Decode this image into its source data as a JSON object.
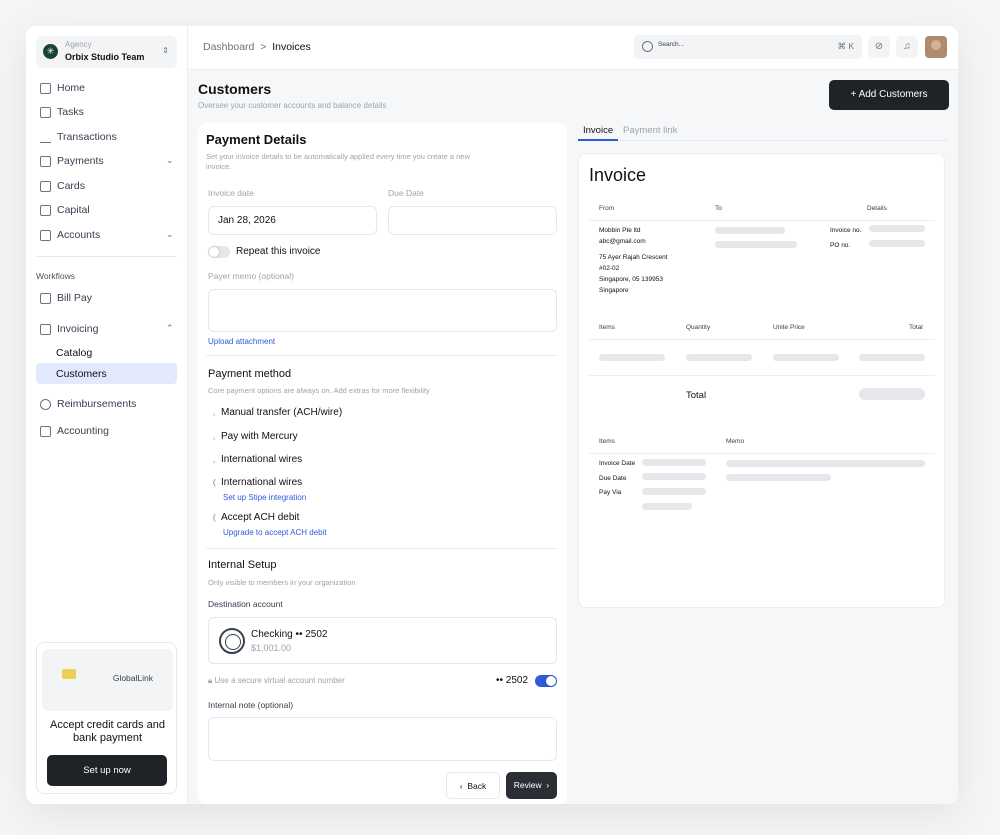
{
  "sidebar": {
    "team": {
      "org": "Agency",
      "name": "Orbix Studio Team"
    },
    "items": [
      {
        "label": "Home"
      },
      {
        "label": "Tasks"
      },
      {
        "label": "Transactions"
      },
      {
        "label": "Payments"
      },
      {
        "label": "Cards"
      },
      {
        "label": "Capital"
      },
      {
        "label": "Accounts"
      }
    ],
    "workflows_label": "Workflows",
    "workflows": [
      {
        "label": "Bill Pay"
      },
      {
        "label": "Invoicing"
      },
      {
        "label": "Catalog"
      },
      {
        "label": "Customers"
      },
      {
        "label": "Reimbursements"
      },
      {
        "label": "Accounting"
      }
    ],
    "promo": {
      "brand": "GlobalLink",
      "message": "Accept credit cards and bank payment",
      "button": "Set up now"
    }
  },
  "header": {
    "breadcrumb_root": "Dashboard",
    "breadcrumb_sep": ">",
    "breadcrumb_current": "Invoices",
    "search_placeholder": "Search...",
    "shortcut": "⌘ K"
  },
  "page": {
    "title": "Customers",
    "subtitle": "Oversee your customer accounts and balance details",
    "add_button": "+ Add Customers"
  },
  "form": {
    "title": "Payment Details",
    "description": "Set your invoice details to be automatically applied every time you create a new invoice.",
    "invoice_date_label": "Invoice date",
    "invoice_date_value": "Jan 28, 2026",
    "due_date_label": "Due Date",
    "due_date_value": "",
    "repeat_label": "Repeat this invoice",
    "memo_label": "Payer memo (optional)",
    "upload_label": "Upload attachment",
    "payment_method_title": "Payment method",
    "payment_method_desc": "Core payment options are always on. Add extras for more flexibility",
    "methods": [
      {
        "label": "Manual transfer (ACH/wire)"
      },
      {
        "label": "Pay with Mercury"
      },
      {
        "label": "International wires"
      },
      {
        "label": "International wires",
        "link": "Set up Stipe integration"
      },
      {
        "label": "Accept ACH debit",
        "link": "Upgrade to accept ACH debit"
      }
    ],
    "internal_title": "Internal Setup",
    "internal_desc": "Only visible to members in your organization",
    "dest_label": "Destination account",
    "account_name": "Checking •• 2502",
    "account_balance": "$1,001.00",
    "virtual_label": "Use a secure virtual account number",
    "virtual_value": "•• 2502",
    "virtual_enabled": true,
    "internal_note_label": "Internal note (optional)",
    "back_label": "Back",
    "review_label": "Review"
  },
  "preview": {
    "tabs": [
      {
        "label": "Invoice"
      },
      {
        "label": "Payment link"
      }
    ],
    "title": "Invoice",
    "from_label": "From",
    "to_label": "To",
    "details_label": "Details",
    "from_name": "Mobbin Pte ltd",
    "from_email": "abc@gmail.com",
    "address": [
      "75 Ayer Rajah Crescent",
      "#02-02",
      "Singapore, 05 139953",
      "Singapore"
    ],
    "invoice_no_label": "Invoice no.",
    "po_no_label": "PO no.",
    "items_header": [
      "Items",
      "Quantity",
      "Unite Price",
      "Total"
    ],
    "total_label": "Total",
    "bottom_header": [
      "Items",
      "Memo"
    ],
    "bottom_labels": [
      "Invoice Date",
      "Due Date",
      "Pay Via"
    ]
  }
}
